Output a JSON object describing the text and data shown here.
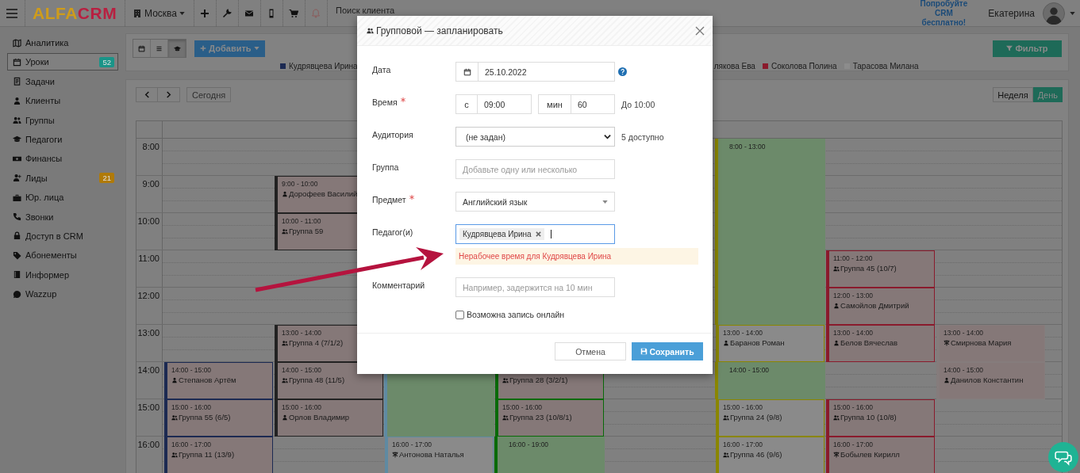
{
  "topbar": {
    "logo_left": "ALFA",
    "logo_right": "CRM",
    "city": "Москва",
    "search_placeholder": "Поиск клиента",
    "promo": "Попробуйте CRM бесплатно!",
    "user": "Екатерина"
  },
  "sidebar": {
    "items": [
      {
        "label": "Аналитика",
        "selected": false
      },
      {
        "label": "Уроки",
        "selected": true,
        "badge": "52",
        "color": "#1a9488"
      },
      {
        "label": "Задачи",
        "selected": false
      },
      {
        "label": "Клиенты",
        "selected": false
      },
      {
        "label": "Группы",
        "selected": false
      },
      {
        "label": "Педагоги",
        "selected": false
      },
      {
        "label": "Финансы",
        "selected": false
      },
      {
        "label": "Лиды",
        "selected": false,
        "badge": "21",
        "color": "#b07a08"
      },
      {
        "label": "Юр. лица",
        "selected": false
      },
      {
        "label": "Звонки",
        "selected": false
      },
      {
        "label": "Доступ в CRM",
        "selected": false
      },
      {
        "label": "Абонементы",
        "selected": false
      },
      {
        "label": "Информер",
        "selected": false
      },
      {
        "label": "Wazzup",
        "selected": false
      }
    ]
  },
  "toolbar": {
    "views": [
      {
        "selected": false
      },
      {
        "selected": false
      },
      {
        "selected": true
      }
    ],
    "add_button": "Добавить",
    "filter_button": "Фильтр",
    "legend": [
      {
        "name": "Кудрявцева Ирина",
        "color": "#1c2a52"
      },
      {
        "name": "лякова Ева"
      },
      {
        "name": "Соколова Полина",
        "color": "#8a1a2c"
      },
      {
        "name": "Тарасова Милана",
        "color": "#8c8c8c"
      }
    ]
  },
  "calendar": {
    "today_button": "Сегодня",
    "ranges": [
      {
        "label": "Неделя",
        "selected": false
      },
      {
        "label": "День",
        "selected": true
      }
    ],
    "hours": [
      "8:00",
      "9:00",
      "10:00",
      "11:00",
      "12:00",
      "13:00",
      "14:00",
      "15:00",
      "16:00"
    ],
    "columns": [
      {
        "color": "#1c2a52",
        "items": [
          {
            "kind": "individual",
            "time": "14:00 - 15:00",
            "title": "Степанов Артём",
            "highlighted": true
          },
          {
            "kind": "group",
            "time": "15:00 - 16:00",
            "title": "Группа 55 (6/5)",
            "highlighted": true
          },
          {
            "kind": "group",
            "time": "16:00 - 17:00",
            "title": "Группа 11 (13/9)",
            "highlighted": true
          }
        ]
      },
      {
        "color": "#222222",
        "items": [
          {
            "kind": "individual",
            "time": "9:00 - 10:00",
            "title": "Дорофеев Василий",
            "highlighted": true
          },
          {
            "kind": "group",
            "time": "10:00 - 11:00",
            "title": "Группа 59",
            "highlighted": true
          },
          {
            "kind": "group",
            "time": "13:00 - 14:00",
            "title": "Группа 4 (7/1/2)",
            "highlighted": true
          },
          {
            "kind": "group",
            "time": "14:00 - 15:00",
            "title": "Группа 48 (11/5)",
            "highlighted": true
          },
          {
            "kind": "individual",
            "time": "15:00 - 16:00",
            "title": "Орлов Владимир",
            "highlighted": true
          }
        ]
      },
      {
        "color": "#5f8aa2",
        "items": [
          {
            "kind": "free"
          },
          {
            "kind": "trial",
            "time": "16:00 - 17:00",
            "title": "Антонова Наталья",
            "highlighted": false
          }
        ]
      },
      {
        "color": "#086a08",
        "items": [
          {
            "kind": "group",
            "title": "Группа 28 (3/2/1)",
            "highlighted": true
          },
          {
            "kind": "group",
            "time": "15:00 - 16:00",
            "title": "Группа 23 (10/8/1)",
            "highlighted": true
          },
          {
            "kind": "free",
            "time": "16:00 - 19:00"
          }
        ]
      },
      {},
      {
        "color": "#8a8600",
        "items": [
          {
            "kind": "free",
            "time": "8:00 - 13:00"
          },
          {
            "kind": "individual",
            "time": "13:00 - 14:00",
            "title": "Баранов Роман",
            "highlighted": false
          },
          {
            "kind": "free",
            "time": "14:00 - 15:00"
          },
          {
            "kind": "group",
            "time": "15:00 - 16:00",
            "title": "Группа 24 (9/8)",
            "highlighted": false
          },
          {
            "kind": "group",
            "time": "16:00 - 17:00",
            "title": "Группа 46 (9/6)",
            "highlighted": false
          }
        ]
      },
      {
        "color": "#8a1a2c",
        "items": [
          {
            "kind": "group",
            "time": "11:00 - 12:00",
            "title": "Группа 45 (10/7)",
            "highlighted": true
          },
          {
            "kind": "individual",
            "time": "12:00 - 13:00",
            "title": "Самойлов Дмитрий",
            "highlighted": true
          },
          {
            "kind": "individual",
            "time": "13:00 - 14:00",
            "title": "Белов Вячеслав",
            "highlighted": true
          },
          {
            "kind": "group",
            "time": "15:00 - 16:00",
            "title": "Группа 10 (10/8)",
            "highlighted": true
          },
          {
            "kind": "trial",
            "time": "16:00 - 17:00",
            "title": "Бобылев Кирилл",
            "highlighted": true
          }
        ]
      },
      {
        "color": "#857c7c",
        "items": [
          {
            "kind": "trial",
            "time": "13:00 - 14:00",
            "title": "Смирнова Мария",
            "highlighted": true
          },
          {
            "kind": "individual",
            "time": "14:00 - 15:00",
            "title": "Данилов Константин",
            "highlighted": true
          }
        ]
      }
    ]
  },
  "modal": {
    "title": "Групповой — запланировать",
    "fields": [
      {
        "kind": "date",
        "label": "Дата",
        "required": false,
        "value": "25.10.2022"
      },
      {
        "kind": "time",
        "label": "Время",
        "required": true,
        "from_label": "с",
        "value": "09:00",
        "duration_label": "мин",
        "duration": "60",
        "note": "До 10:00"
      },
      {
        "kind": "select",
        "label": "Аудитория",
        "required": false,
        "value": "(не задан)",
        "note": "5 доступно"
      },
      {
        "kind": "text",
        "label": "Группа",
        "required": false,
        "placeholder": "Добавьте одну или несколько"
      },
      {
        "kind": "combo",
        "label": "Предмет",
        "required": true,
        "value": "Английский язык"
      },
      {
        "kind": "tags",
        "label": "Педагог(и)",
        "required": false,
        "tags": [
          "Кудрявцева Ирина"
        ],
        "warning": "Нерабочее время для Кудрявцева Ирина"
      },
      {
        "kind": "text",
        "label": "Комментарий",
        "required": false,
        "placeholder": "Например, задержится на 10 мин"
      }
    ],
    "checkbox": {
      "label": "Возможна запись онлайн",
      "checked": false
    },
    "buttons": [
      {
        "label": "Отмена",
        "kind": "secondary"
      },
      {
        "label": "Сохранить",
        "kind": "primary"
      }
    ]
  }
}
